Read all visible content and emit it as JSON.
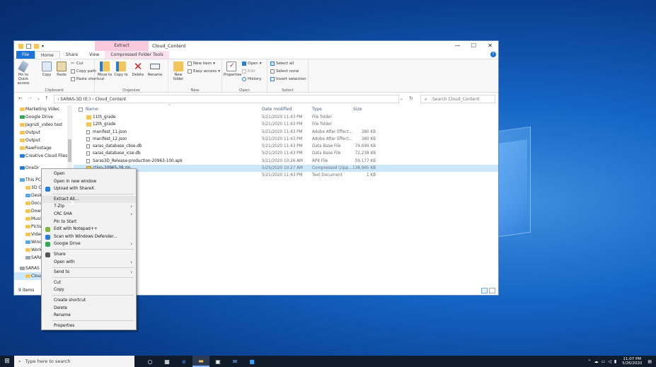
{
  "window": {
    "title": "Cloud_Content",
    "context_tab": "Extract",
    "controls": [
      "—",
      "☐",
      "✕"
    ]
  },
  "ribbon_tabs": [
    "File",
    "Home",
    "Share",
    "View",
    "Compressed Folder Tools"
  ],
  "ribbon": {
    "clipboard": {
      "label": "Clipboard",
      "pin": "Pin to Quick access",
      "copy": "Copy",
      "paste": "Paste",
      "cut": "Cut",
      "copy_path": "Copy path",
      "paste_shortcut": "Paste shortcut"
    },
    "organize": {
      "label": "Organize",
      "move_to": "Move to",
      "copy_to": "Copy to",
      "delete": "Delete",
      "rename": "Rename"
    },
    "new": {
      "label": "New",
      "new_folder": "New folder",
      "new_item": "New item",
      "easy_access": "Easy access"
    },
    "open": {
      "label": "Open",
      "properties": "Properties",
      "open": "Open",
      "edit": "Edit",
      "history": "History"
    },
    "select": {
      "label": "Select",
      "select_all": "Select all",
      "select_none": "Select none",
      "invert": "Invert selection"
    }
  },
  "address": {
    "path": "›  SARAS-3D (E:)  ›  Cloud_Content",
    "search_placeholder": "Search Cloud_Content"
  },
  "nav_items": [
    "Marketing Videc",
    "Google Drive",
    "Jagruti_video test",
    "Output",
    "Output",
    "RawFootage",
    "Creative Cloud Files",
    "OneDr",
    "This PC",
    "3D O",
    "Deskt",
    "Docu",
    "Down",
    "Musi",
    "Pictu",
    "Video",
    "Wind",
    "Work",
    "SARA",
    "SARAS",
    "Cloud"
  ],
  "columns": {
    "name": "Name",
    "date": "Date modified",
    "type": "Type",
    "size": "Size"
  },
  "files": [
    {
      "name": "11th_grade",
      "date": "5/21/2020 11:43 PM",
      "type": "File folder",
      "size": "",
      "kind": "folder"
    },
    {
      "name": "12th_grade",
      "date": "5/21/2020 11:43 PM",
      "type": "File folder",
      "size": "",
      "kind": "folder"
    },
    {
      "name": "manifest_11.json",
      "date": "5/21/2020 11:43 PM",
      "type": "Adobe After Effect...",
      "size": "380 KB",
      "kind": "doc"
    },
    {
      "name": "manifest_12.json",
      "date": "5/21/2020 11:43 PM",
      "type": "Adobe After Effect...",
      "size": "380 KB",
      "kind": "doc"
    },
    {
      "name": "saras_database_cbse.db",
      "date": "5/21/2020 11:43 PM",
      "type": "Data Base File",
      "size": "74,699 KB",
      "kind": "doc"
    },
    {
      "name": "saras_database_icse.db",
      "date": "5/21/2020 11:43 PM",
      "type": "Data Base File",
      "size": "72,238 KB",
      "kind": "doc"
    },
    {
      "name": "Saras3D_Release-production-20963-100.apk",
      "date": "5/21/2020 10:26 AM",
      "type": "APK File",
      "size": "59,177 KB",
      "kind": "doc"
    },
    {
      "name": "ction-20965-39.zip",
      "date": "5/25/2020 10:27 AM",
      "type": "Compressed (zipp...",
      "size": "138,965 KB",
      "kind": "zip",
      "selected": true
    },
    {
      "name": "",
      "date": "5/21/2020 11:43 PM",
      "type": "Text Document",
      "size": "1 KB",
      "kind": "doc"
    }
  ],
  "status": {
    "items": "9 items"
  },
  "context_menu": [
    {
      "label": "Open",
      "submenu": false
    },
    {
      "label": "Open in new window",
      "submenu": false
    },
    {
      "label": "Upload with ShareX",
      "submenu": false,
      "icon": "sharex"
    },
    {
      "sep": true
    },
    {
      "label": "Extract All...",
      "submenu": false,
      "highlight": true
    },
    {
      "label": "7-Zip",
      "submenu": true
    },
    {
      "label": "CRC SHA",
      "submenu": true
    },
    {
      "label": "Pin to Start",
      "submenu": false
    },
    {
      "label": "Edit with Notepad++",
      "submenu": false,
      "icon": "notepad"
    },
    {
      "label": "Scan with Windows Defender...",
      "submenu": false,
      "icon": "defender"
    },
    {
      "label": "Google Drive",
      "submenu": true,
      "icon": "gdrive"
    },
    {
      "sep": true
    },
    {
      "label": "Share",
      "submenu": false,
      "icon": "share"
    },
    {
      "label": "Open with",
      "submenu": true
    },
    {
      "sep": true
    },
    {
      "label": "Send to",
      "submenu": true
    },
    {
      "sep": true
    },
    {
      "label": "Cut",
      "submenu": false
    },
    {
      "label": "Copy",
      "submenu": false
    },
    {
      "sep": true
    },
    {
      "label": "Create shortcut",
      "submenu": false
    },
    {
      "label": "Delete",
      "submenu": false
    },
    {
      "label": "Rename",
      "submenu": false
    },
    {
      "sep": true
    },
    {
      "label": "Properties",
      "submenu": false
    }
  ],
  "taskbar": {
    "search_placeholder": "Type here to search",
    "time": "11:07 PM",
    "date": "5/26/2020"
  }
}
